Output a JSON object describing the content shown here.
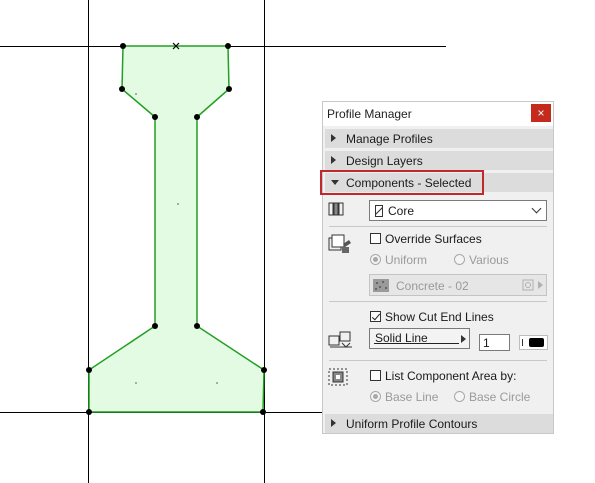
{
  "panel": {
    "title": "Profile Manager",
    "close_glyph": "×",
    "sections": {
      "manage_profiles": "Manage Profiles",
      "design_layers": "Design Layers",
      "components_selected": "Components - Selected",
      "uniform_profile_contours": "Uniform Profile Contours"
    },
    "core": {
      "value": "Core",
      "icon": "core-component-icon"
    },
    "surfaces": {
      "override_label": "Override Surfaces",
      "override_checked": false,
      "uniform_label": "Uniform",
      "various_label": "Various",
      "material_value": "Concrete - 02"
    },
    "cut_end_lines": {
      "show_label": "Show Cut End Lines",
      "show_checked": true,
      "line_type": "Solid Line",
      "pen_number": "1"
    },
    "component_area": {
      "list_label": "List Component Area by:",
      "list_checked": false,
      "base_line_label": "Base Line",
      "base_circle_label": "Base Circle"
    }
  },
  "colors": {
    "profile_fill": "#e3fae3",
    "profile_stroke": "#22a022",
    "highlight": "#c0282d",
    "close_button": "#c42b1c"
  }
}
